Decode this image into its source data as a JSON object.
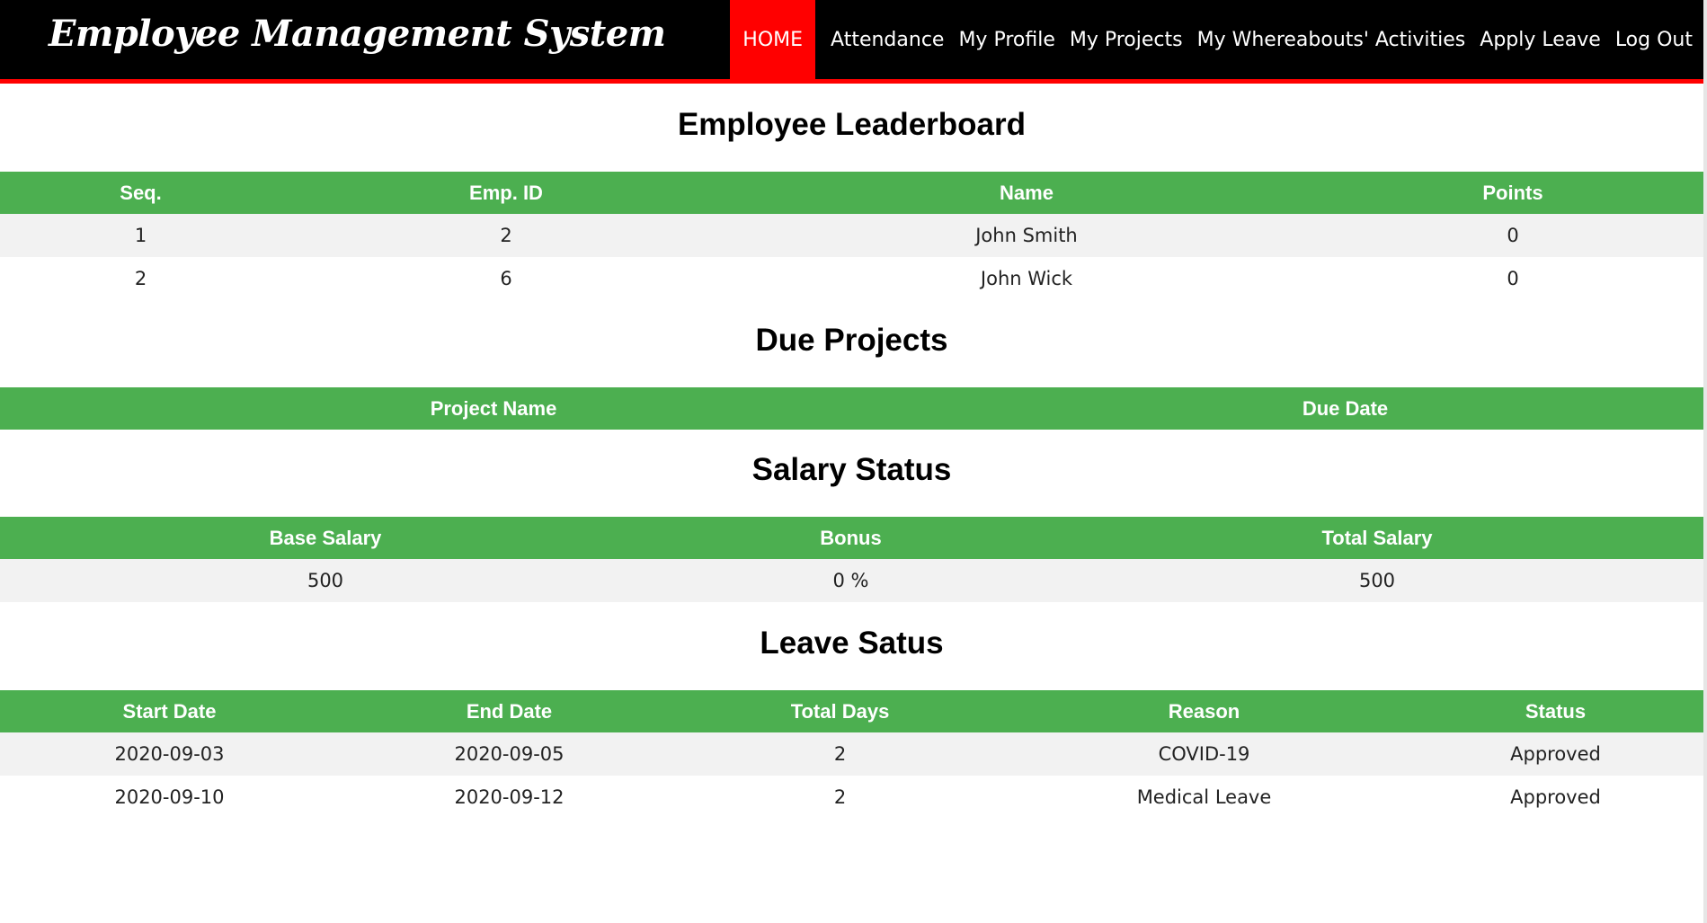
{
  "app": {
    "title": "Employee Management System"
  },
  "nav": {
    "items": [
      {
        "label": "HOME",
        "active": true
      },
      {
        "label": "Attendance"
      },
      {
        "label": "My Profile"
      },
      {
        "label": "My Projects"
      },
      {
        "label": "My Whereabouts' Activities"
      },
      {
        "label": "Apply Leave"
      },
      {
        "label": "Log Out"
      }
    ]
  },
  "leaderboard": {
    "title": "Employee Leaderboard",
    "columns": [
      "Seq.",
      "Emp. ID",
      "Name",
      "Points"
    ],
    "rows": [
      [
        "1",
        "2",
        "John Smith",
        "0"
      ],
      [
        "2",
        "6",
        "John Wick",
        "0"
      ]
    ]
  },
  "due_projects": {
    "title": "Due Projects",
    "columns": [
      "Project Name",
      "Due Date"
    ],
    "rows": []
  },
  "salary": {
    "title": "Salary Status",
    "columns": [
      "Base Salary",
      "Bonus",
      "Total Salary"
    ],
    "rows": [
      [
        "500",
        "0 %",
        "500"
      ]
    ]
  },
  "leave": {
    "title": "Leave Satus",
    "columns": [
      "Start Date",
      "End Date",
      "Total Days",
      "Reason",
      "Status"
    ],
    "rows": [
      [
        "2020-09-03",
        "2020-09-05",
        "2",
        "COVID-19",
        "Approved"
      ],
      [
        "2020-09-10",
        "2020-09-12",
        "2",
        "Medical Leave",
        "Approved"
      ]
    ]
  },
  "colors": {
    "header_bg": "#000000",
    "accent_red": "#ff0000",
    "table_header_green": "#4caf50",
    "row_stripe": "#f2f2f2"
  }
}
